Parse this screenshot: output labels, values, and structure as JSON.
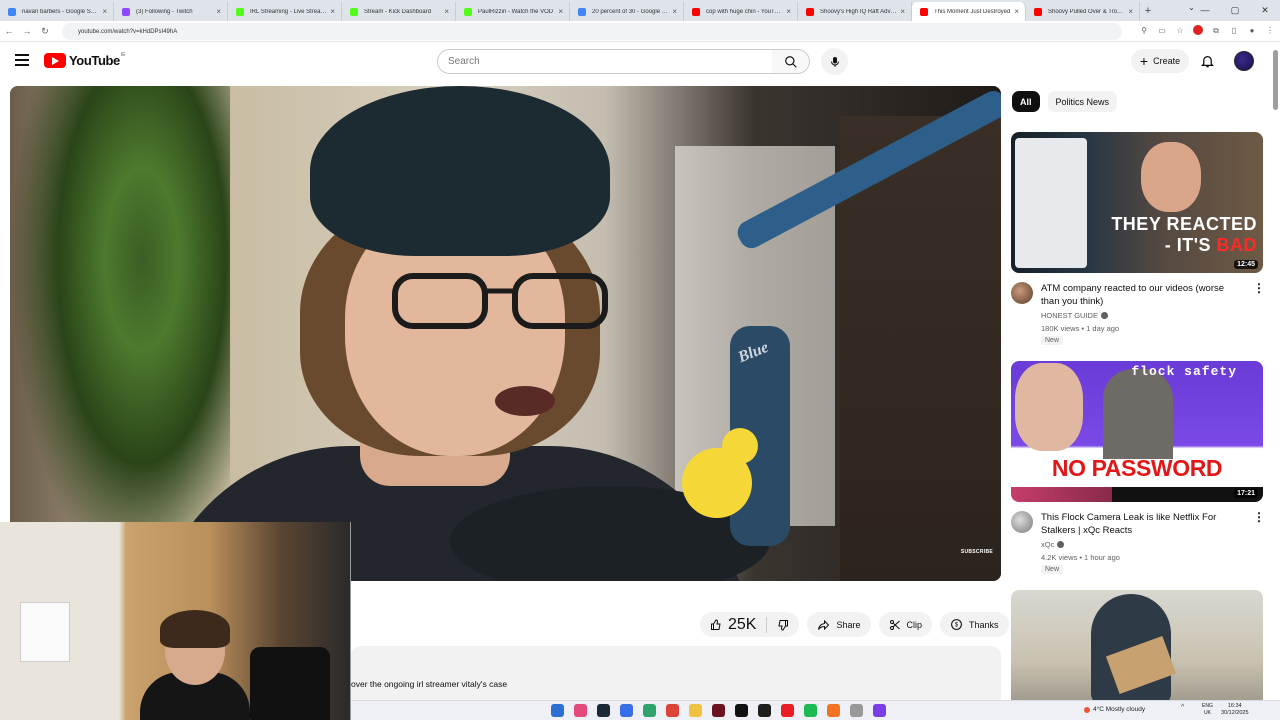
{
  "browser": {
    "tabs": [
      {
        "title": "navan barbers - Google Search",
        "color": "#4285f4"
      },
      {
        "title": "(3) Following - Twitch",
        "color": "#9146ff"
      },
      {
        "title": "IRL Streaming - Live Streams",
        "color": "#53fc18"
      },
      {
        "title": "Stream - Kick Dashboard",
        "color": "#53fc18"
      },
      {
        "title": "PaulRizzin - Watch the VOD",
        "color": "#53fc18"
      },
      {
        "title": "20 percent of 30 - Google Search",
        "color": "#4285f4"
      },
      {
        "title": "cop with huge chin - YouTube",
        "color": "#ff0000"
      },
      {
        "title": "Shoovy's High IQ Raft Adventure",
        "color": "#ff0000"
      },
      {
        "title": "This Moment Just Destroyed",
        "color": "#ff0000",
        "active": true
      },
      {
        "title": "Shoovy Pulled Over & Troopers",
        "color": "#ff0000"
      }
    ],
    "url": "youtube.com/watch?v=kHdDPsI49hA"
  },
  "header": {
    "logo_text": "YouTube",
    "logo_sup": "IE",
    "search_placeholder": "Search",
    "create_label": "Create"
  },
  "player": {
    "watermark": "SUBSCRIBE",
    "mic_brand": "Blue"
  },
  "actions": {
    "likes": "25K",
    "share": "Share",
    "clip": "Clip",
    "thanks": "Thanks"
  },
  "description": {
    "text": "over the ongoing irl streamer vitaly's case"
  },
  "sidebar": {
    "chips": [
      "All",
      "Politics News"
    ],
    "videos": [
      {
        "title": "ATM company reacted to our videos (worse than you think)",
        "channel": "HONEST GUIDE",
        "stats": "180K views • 1 day ago",
        "badge": "New",
        "duration": "12:45",
        "thumb_line1": "THEY REACTED",
        "thumb_line2a": "- IT'S ",
        "thumb_line2b": "BAD"
      },
      {
        "title": "This Flock Camera Leak is like Netflix For Stalkers | xQc Reacts",
        "channel": "xQc",
        "stats": "4.2K views • 1 hour ago",
        "badge": "New",
        "duration": "17:21",
        "thumb_top": "flock safety",
        "thumb_main": "NO PASSWORD REQUIRED"
      }
    ]
  },
  "taskbar": {
    "weather": "4°C  Mostly cloudy",
    "lang_line1": "ENG",
    "lang_line2": "UK",
    "time": "16:34",
    "date": "30/12/2025"
  },
  "colors": {
    "accent": "#ff0000",
    "chip_active": "#0f0f0f",
    "chip_bg": "#f2f2f2"
  }
}
